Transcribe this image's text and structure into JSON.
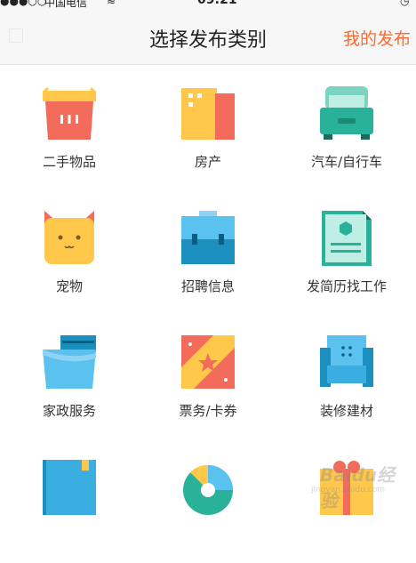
{
  "status_bar": {
    "signal": "●●●○○",
    "carrier": "中国电信",
    "time": "09:21"
  },
  "navbar": {
    "title": "选择发布类别",
    "right_action": "我的发布"
  },
  "categories": [
    {
      "label": "二手物品",
      "icon": "shopping-basket-icon"
    },
    {
      "label": "房产",
      "icon": "building-icon"
    },
    {
      "label": "汽车/自行车",
      "icon": "car-icon"
    },
    {
      "label": "宠物",
      "icon": "cat-icon"
    },
    {
      "label": "招聘信息",
      "icon": "briefcase-icon"
    },
    {
      "label": "发简历找工作",
      "icon": "resume-document-icon"
    },
    {
      "label": "家政服务",
      "icon": "cleaning-bucket-icon"
    },
    {
      "label": "票务/卡券",
      "icon": "ticket-icon"
    },
    {
      "label": "装修建材",
      "icon": "armchair-icon"
    },
    {
      "label": "",
      "icon": "book-icon"
    },
    {
      "label": "",
      "icon": "pie-chart-icon"
    },
    {
      "label": "",
      "icon": "gift-icon"
    }
  ],
  "watermark": {
    "brand": "Baidu经验",
    "url": "jingyan.baidu.com"
  },
  "colors": {
    "accent": "#ff6a2c",
    "navbar_bg": "#f7f7f7"
  }
}
